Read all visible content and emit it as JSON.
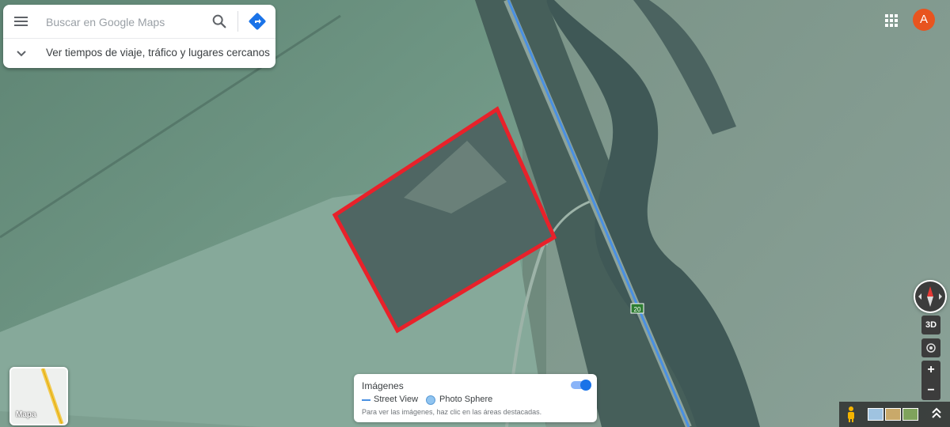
{
  "search": {
    "placeholder": "Buscar en Google Maps",
    "travel_text": "Ver tiempos de viaje, tráfico y lugares cercanos"
  },
  "account": {
    "avatar_letter": "A"
  },
  "controls": {
    "btn_3d": "3D",
    "zoom_in": "+",
    "zoom_out": "−"
  },
  "layers": {
    "label": "Mapa"
  },
  "imagery": {
    "title": "Imágenes",
    "street_view": "Street View",
    "photo_sphere": "Photo Sphere",
    "hint": "Para ver las imágenes, haz clic en las áreas destacadas.",
    "toggle_on": true
  },
  "map": {
    "route_shield": "20",
    "colors": {
      "highlight": "#e8212a",
      "street_view_line": "#4a90e2",
      "brand_blue": "#1a73e8",
      "avatar": "#e8541f"
    }
  }
}
